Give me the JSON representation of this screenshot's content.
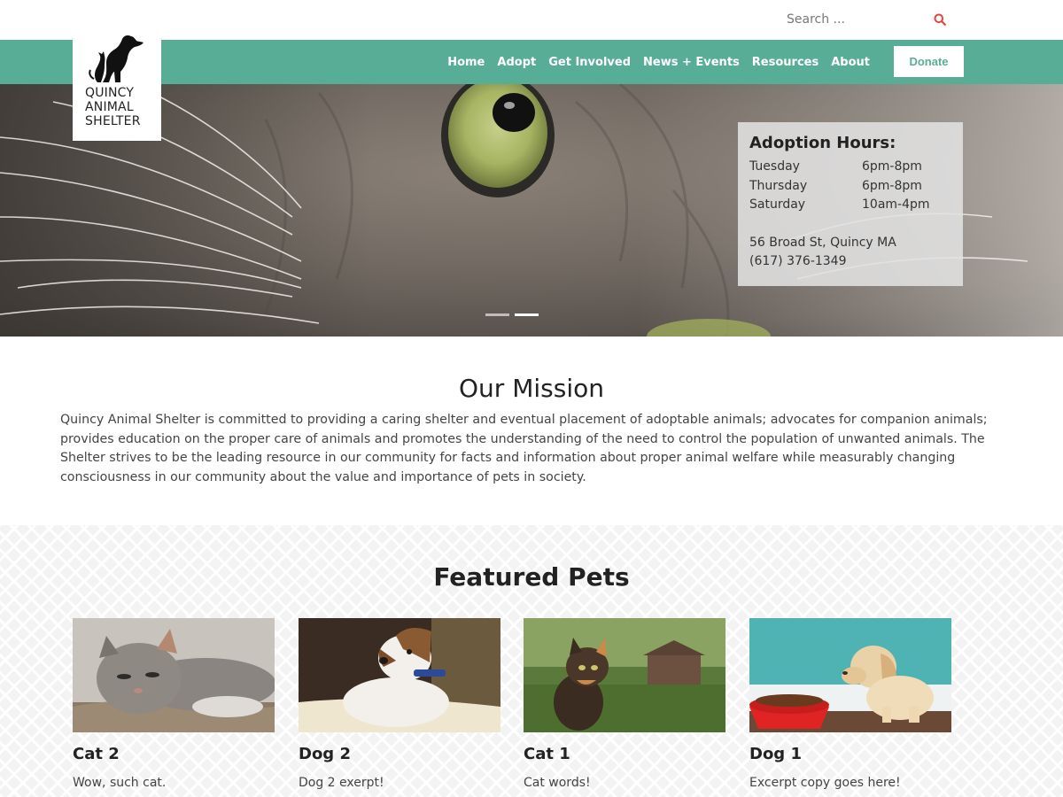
{
  "search": {
    "placeholder": "Search ..."
  },
  "logo": {
    "line1": "QUINCY",
    "line2": "ANIMAL",
    "line3": "SHELTER"
  },
  "nav": {
    "items": [
      "Home",
      "Adopt",
      "Get Involved",
      "News + Events",
      "Resources",
      "About"
    ],
    "donate": "Donate"
  },
  "hours": {
    "title": "Adoption Hours:",
    "rows": [
      {
        "day": "Tuesday",
        "time": "6pm-8pm"
      },
      {
        "day": "Thursday",
        "time": "6pm-8pm"
      },
      {
        "day": "Saturday",
        "time": "10am-4pm"
      }
    ],
    "address": "56 Broad St, Quincy MA",
    "phone": "(617) 376-1349"
  },
  "slider": {
    "active_index": 1,
    "count": 2
  },
  "mission": {
    "title": "Our Mission",
    "text": "Quincy Animal Shelter is committed to providing a caring shelter and eventual placement of adoptable animals; advocates for companion animals; provides education on the proper care of animals and promotes the understanding of the need to control the population of unwanted animals. The Shelter strives to be the leading resource in our community for facts and information about proper animal welfare while measurably changing consciousness in our community about the value and importance of pets in society."
  },
  "featured": {
    "title": "Featured Pets",
    "pets": [
      {
        "name": "Cat 2",
        "excerpt": "Wow, such cat."
      },
      {
        "name": "Dog 2",
        "excerpt": "Dog 2 exerpt!"
      },
      {
        "name": "Cat 1",
        "excerpt": "Cat words!"
      },
      {
        "name": "Dog 1",
        "excerpt": "Excerpt copy goes here!"
      }
    ]
  },
  "colors": {
    "accent": "#58ad96",
    "search_icon": "#e0483e"
  }
}
